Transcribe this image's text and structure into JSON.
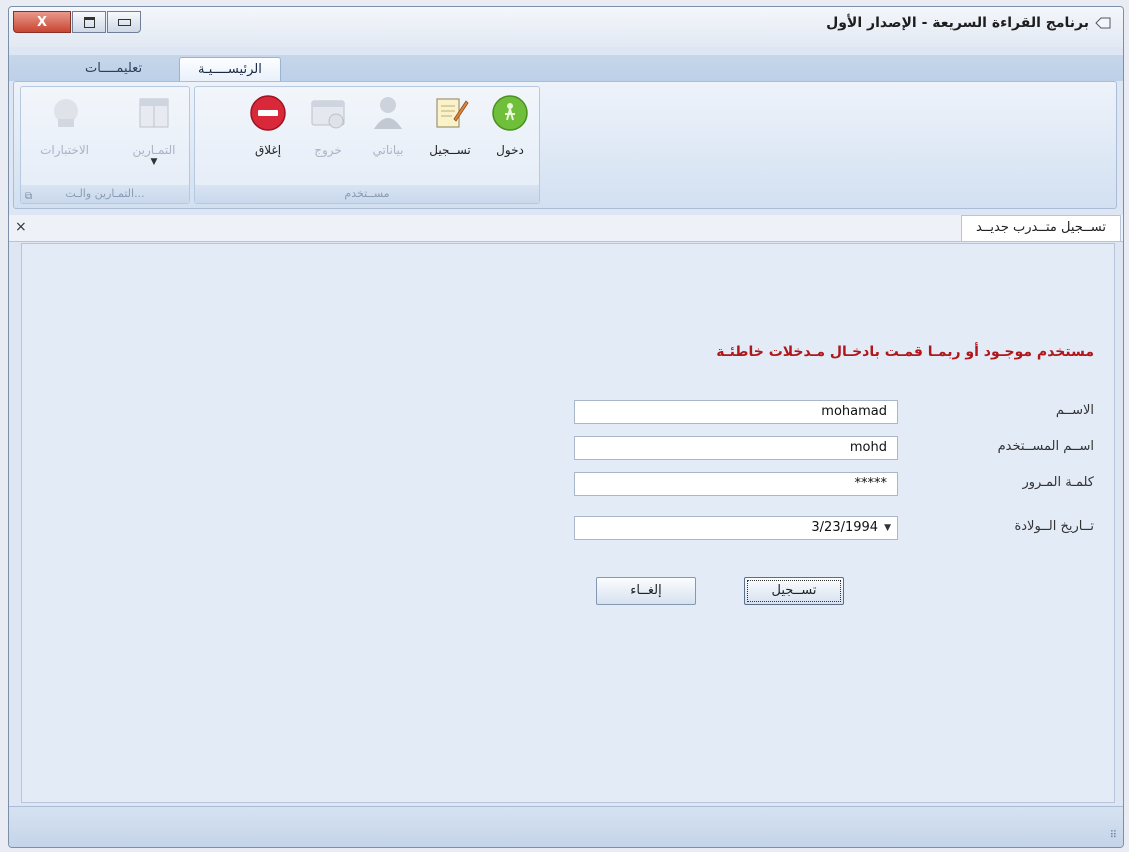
{
  "window": {
    "title": "برنامج القراءة السريعة - الإصدار الأول",
    "close_label": "X"
  },
  "ribbon": {
    "tabs": [
      {
        "label": "الرئيســــيـة",
        "active": true
      },
      {
        "label": "تعليمــــات",
        "active": false
      }
    ],
    "groups": {
      "user": {
        "label": "مســتخدم",
        "buttons": [
          {
            "label": "دخول",
            "icon": "login-icon",
            "enabled": true
          },
          {
            "label": "تســجيل",
            "icon": "register-icon",
            "enabled": true
          },
          {
            "label": "بياناتي",
            "icon": "user-profile-icon",
            "enabled": false
          },
          {
            "label": "خروج",
            "icon": "logout-icon",
            "enabled": false
          },
          {
            "label": "إغلاق",
            "icon": "close-app-icon",
            "enabled": true
          }
        ]
      },
      "exercises": {
        "label": "...التمـارين والـت",
        "buttons": [
          {
            "label": "التمـارين",
            "icon": "exercises-icon",
            "enabled": false
          },
          {
            "label": "الاختبارات",
            "icon": "tests-icon",
            "enabled": false
          }
        ]
      }
    }
  },
  "document_tab": {
    "label": "تســجيل متــدرب جديــد",
    "close_label": "×"
  },
  "form": {
    "error_message": "مستخدم موجـود أو ربمـا قمـت بادخـال مـدخلات خاطئـة",
    "fields": {
      "name": {
        "label": "الاســم",
        "value": "mohamad"
      },
      "username": {
        "label": "اســم المســتخدم",
        "value": "mohd"
      },
      "password": {
        "label": "كلمـة المـرور",
        "value": "*****"
      },
      "birthdate": {
        "label": "تــاريخ الــولادة",
        "value": "3/23/1994"
      }
    },
    "buttons": {
      "register": "تســجيل",
      "cancel": "إلغــاء"
    }
  },
  "colors": {
    "error": "#b0161a",
    "close_button": "#c94532"
  }
}
